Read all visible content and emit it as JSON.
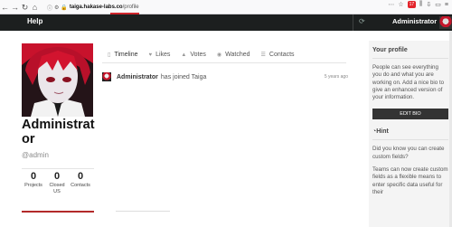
{
  "browser": {
    "back_icon": "back-arrow-icon",
    "forward_icon": "forward-arrow-icon",
    "reload_icon": "reload-icon",
    "home_icon": "home-icon",
    "url_host": "taiga.hakase-labs.co",
    "url_path": "/profile",
    "extension_badge": "17",
    "accent": "#d0262d"
  },
  "header": {
    "help_label": "Help",
    "user_label": "Administrator",
    "background": "#1c1f1f"
  },
  "profile": {
    "name": "Administrator",
    "name_line1": "Administrat",
    "name_line2": "or",
    "handle": "@admin",
    "stats": [
      {
        "value": "0",
        "label": "Projects"
      },
      {
        "value": "0",
        "label": "Closed US"
      },
      {
        "value": "0",
        "label": "Contacts"
      }
    ]
  },
  "tabs": [
    {
      "label": "Timeline",
      "icon": "timeline-icon"
    },
    {
      "label": "Likes",
      "icon": "heart-icon"
    },
    {
      "label": "Votes",
      "icon": "votes-icon"
    },
    {
      "label": "Watched",
      "icon": "eye-icon"
    },
    {
      "label": "Contacts",
      "icon": "contacts-icon"
    }
  ],
  "timeline": [
    {
      "user": "Administrator",
      "text": "has joined Taiga",
      "time": "5 years ago"
    }
  ],
  "sidebar": {
    "profile_heading": "Your profile",
    "profile_text": "People can see everything you do and what you are working on. Add a nice bio to give an enhanced version of your information.",
    "edit_bio_label": "EDIT BIO",
    "hint_heading": "Hint",
    "hint_line1": "Did you know you can create custom fields?",
    "hint_line2": "Teams can now create custom fields as a flexible means to enter specific data useful for their"
  }
}
